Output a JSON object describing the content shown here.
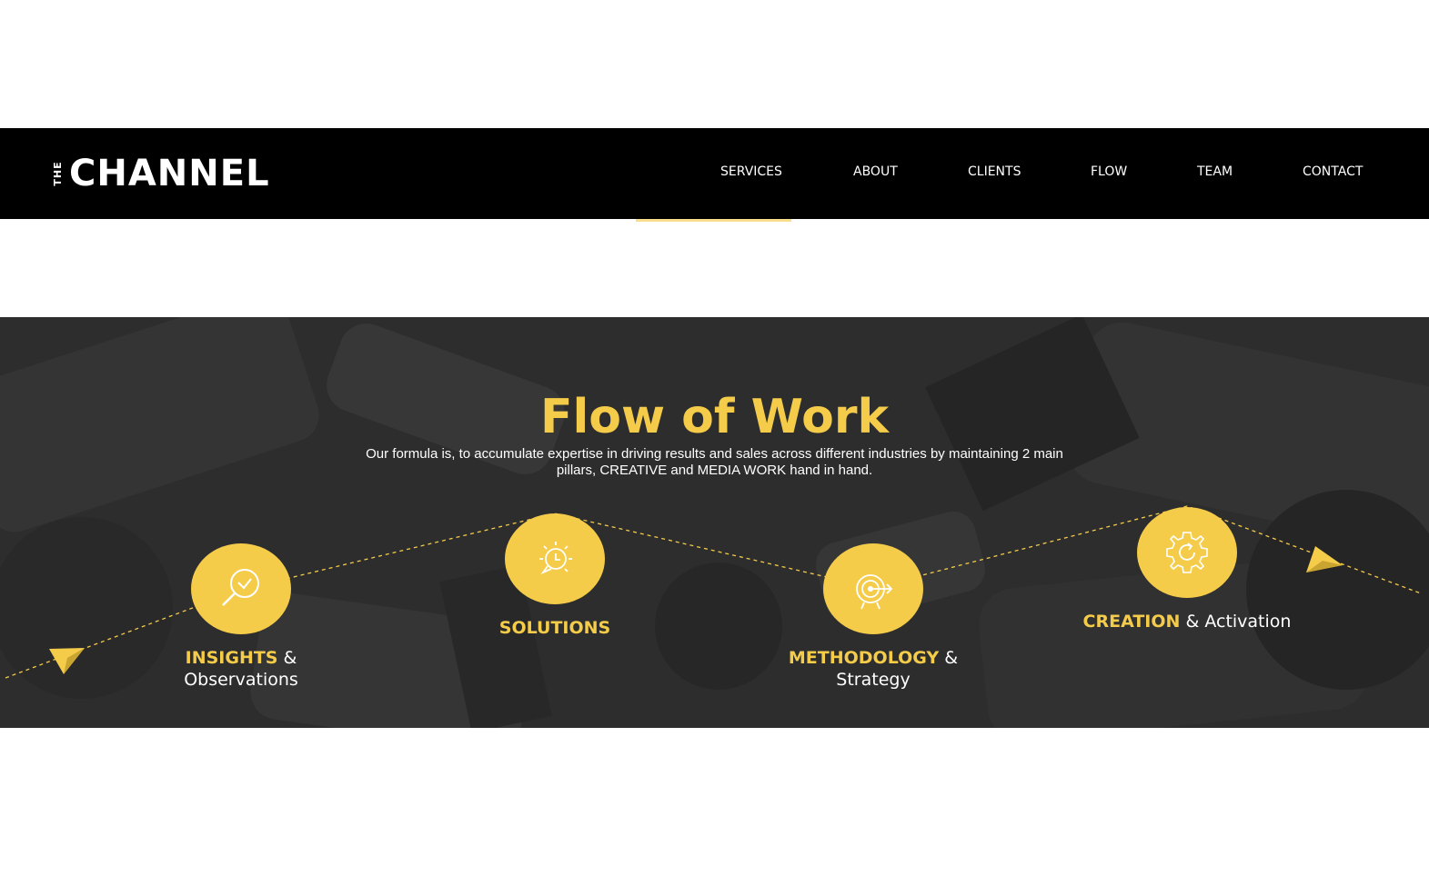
{
  "header": {
    "logo_prefix": "THE",
    "logo_main": "CHANNEL",
    "nav": [
      "SERVICES",
      "ABOUT",
      "CLIENTS",
      "FLOW",
      "TEAM",
      "CONTACT"
    ]
  },
  "flow": {
    "title": "Flow of Work",
    "description": "Our formula is, to accumulate expertise in driving results and sales across different industries by maintaining 2 main pillars, CREATIVE and MEDIA WORK hand in hand.",
    "steps": [
      {
        "highlight": "INSIGHTS",
        "joiner": "&",
        "rest": "Observations",
        "icon": "magnifier-check-icon"
      },
      {
        "highlight": "SOLUTIONS",
        "joiner": "",
        "rest": "",
        "icon": "lightbulb-chat-icon"
      },
      {
        "highlight": "METHODOLOGY",
        "joiner": "&",
        "rest": "Strategy",
        "icon": "target-arrow-icon"
      },
      {
        "highlight": "CREATION",
        "joiner": "&",
        "rest": "Activation",
        "icon": "gear-refresh-icon"
      }
    ]
  },
  "colors": {
    "accent": "#f4cc4a",
    "header_bg": "#000000",
    "section_bg": "#2f2f2f"
  }
}
